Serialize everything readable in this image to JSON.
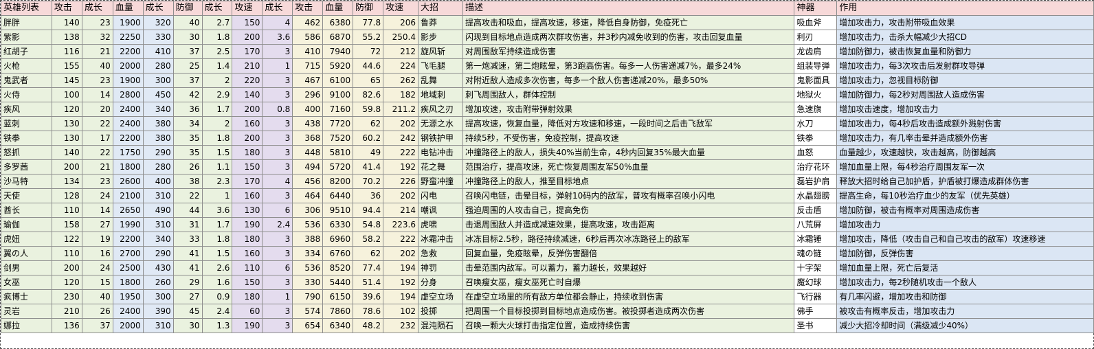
{
  "headers": [
    "英雄列表",
    "攻击",
    "成长",
    "血量",
    "成长",
    "防御",
    "成长",
    "攻速",
    "成长",
    "攻击",
    "血量",
    "防御",
    "攻速",
    "大招",
    "描述",
    "神器",
    "作用"
  ],
  "rows": [
    [
      "胖胖",
      "140",
      "23",
      "1900",
      "320",
      "40",
      "2.7",
      "150",
      "4",
      "462",
      "6380",
      "77.8",
      "206",
      "鲁莽",
      "提高攻击和吸血，提高攻速，移速，降低自身防御，免疫死亡",
      "吸血斧",
      "增加攻击力，攻击附带吸血效果"
    ],
    [
      "紫影",
      "138",
      "32",
      "2250",
      "330",
      "30",
      "1.8",
      "200",
      "3.6",
      "586",
      "6870",
      "55.2",
      "250.4",
      "影步",
      "闪现到目标地点造成两次群攻伤害，并3秒内减免收到的伤害，攻击回复血量",
      "利刃",
      "增加攻击力，击杀大幅减少大招CD"
    ],
    [
      "红胡子",
      "116",
      "21",
      "2200",
      "410",
      "37",
      "2.5",
      "170",
      "3",
      "410",
      "7940",
      "72",
      "212",
      "旋风斩",
      "对周围敌军持续造成伤害",
      "龙齿肩",
      "增加防御力，被击恢复血量和防御力"
    ],
    [
      "火枪",
      "155",
      "40",
      "2000",
      "280",
      "25",
      "1.4",
      "210",
      "1",
      "715",
      "5920",
      "44.6",
      "224",
      "飞毛腿",
      "第一炮减速，第二炮眩晕，第3跑高伤害。每多一人伤害递减7%，最多24%",
      "组装导弹",
      "增加攻击力，每3次攻击后发射群攻导弹"
    ],
    [
      "鬼武者",
      "145",
      "23",
      "1900",
      "300",
      "37",
      "2",
      "220",
      "3",
      "467",
      "6100",
      "65",
      "262",
      "乱舞",
      "对附近敌人造成多次伤害，每多一个敌人伤害递减20%，最多50%",
      "鬼影面具",
      "增加攻击力，忽视目标防御"
    ],
    [
      "火侍",
      "100",
      "14",
      "2800",
      "450",
      "42",
      "2.9",
      "140",
      "3",
      "296",
      "9100",
      "82.6",
      "182",
      "地域刺",
      "刺飞周围敌人，群体控制",
      "地狱火",
      "增加防御力，每2秒对周围敌人造成伤害"
    ],
    [
      "疾风",
      "120",
      "20",
      "2400",
      "340",
      "36",
      "1.7",
      "200",
      "0.8",
      "400",
      "7160",
      "59.8",
      "211.2",
      "疾风之刃",
      "增加攻速，攻击附带弹射效果",
      "急速旗",
      "增加攻击速度，增加攻击力"
    ],
    [
      "蓝刺",
      "130",
      "22",
      "2400",
      "380",
      "34",
      "2",
      "160",
      "3",
      "438",
      "7720",
      "62",
      "202",
      "无源之水",
      "提高攻速，恢复血量，降低对方攻速和移速，一段时间之后击飞敌军",
      "水刀",
      "增加攻击力，每4秒后攻击造成额外溅射伤害"
    ],
    [
      "铁拳",
      "130",
      "17",
      "2200",
      "380",
      "35",
      "1.8",
      "200",
      "3",
      "368",
      "7520",
      "60.2",
      "242",
      "钢铁护甲",
      "持续5秒，不受伤害，免疫控制，提高攻速",
      "铁拳",
      "增加攻击力，有几率击晕并造成额外伤害"
    ],
    [
      "怒抓",
      "140",
      "22",
      "1750",
      "290",
      "35",
      "1.5",
      "180",
      "3",
      "448",
      "5810",
      "49",
      "222",
      "电钻冲击",
      "冲撞路径上的敌人，损失40%当前生命，4秒内回复35%最大血量",
      "血怒",
      "血量越少，攻速越快，攻击越高，防御越高"
    ],
    [
      "多罗茜",
      "200",
      "21",
      "1800",
      "280",
      "26",
      "1.1",
      "150",
      "3",
      "494",
      "5720",
      "41.4",
      "192",
      "花之舞",
      "范围治疗，提高攻速，死亡恢复周围友军50%血量",
      "治疗花环",
      "增加血量上限，每4秒治疗周围友军一次"
    ],
    [
      "沙马特",
      "134",
      "23",
      "2600",
      "400",
      "38",
      "2.3",
      "170",
      "4",
      "456",
      "8200",
      "70.2",
      "226",
      "野蛮冲撞",
      "冲撞路径上的敌人，推至目标地点",
      "磊岩护肩",
      "释放大招时给自己加护盾，护盾被打爆造成群体伤害"
    ],
    [
      "天使",
      "128",
      "24",
      "2100",
      "310",
      "22",
      "1",
      "160",
      "3",
      "464",
      "6440",
      "36",
      "202",
      "闪电",
      "召唤闪电链，击晕目标，弹射10码内的敌军，普攻有概率召唤小闪电",
      "水晶翅膀",
      "提高生命，每10秒治疗血少的友军（优先英雄）"
    ],
    [
      "酋长",
      "110",
      "14",
      "2650",
      "490",
      "44",
      "3.6",
      "130",
      "6",
      "306",
      "9510",
      "94.4",
      "214",
      "嘲讽",
      "强迫周围的人攻击自己，提高免伤",
      "反击盾",
      "增加防御，被击有概率对周围造成伤害"
    ],
    [
      "瑜伽",
      "158",
      "27",
      "1990",
      "310",
      "31",
      "1.7",
      "190",
      "2.4",
      "536",
      "6330",
      "54.8",
      "223.6",
      "虎啸",
      "击退周围敌人并造成减速效果，提高攻速，攻击距离",
      "八荒屏",
      "增加攻击力"
    ],
    [
      "虎妞",
      "122",
      "19",
      "2200",
      "340",
      "33",
      "1.8",
      "180",
      "3",
      "388",
      "6960",
      "58.2",
      "222",
      "冰霜冲击",
      "冰冻目标2.5秒，路径持续减速，6秒后再次冰冻路径上的敌军",
      "冰霜锤",
      "增加攻击，降低（攻击自己和自己攻击的敌军）攻速移速"
    ],
    [
      "翼の人",
      "110",
      "16",
      "2700",
      "290",
      "41",
      "1.5",
      "160",
      "3",
      "334",
      "6760",
      "62",
      "202",
      "急救",
      "回复血量，免疫眩晕，反弹伤害翻倍",
      "魂の链",
      "增加防御，反弹伤害"
    ],
    [
      "剑男",
      "200",
      "24",
      "2500",
      "430",
      "41",
      "2.6",
      "110",
      "6",
      "536",
      "8520",
      "77.4",
      "194",
      "神罚",
      "击晕范围内敌军。可以蓄力，蓄力越长，效果越好",
      "十字架",
      "增加血量上限，死亡后复活"
    ],
    [
      "女巫",
      "120",
      "15",
      "1800",
      "260",
      "29",
      "1.6",
      "150",
      "3",
      "330",
      "5440",
      "51.4",
      "192",
      "分身",
      "召唤瘦女巫，瘦女巫死亡时自爆",
      "魔幻球",
      "增加攻击力，每2秒随机攻击一个敌人"
    ],
    [
      "疯博士",
      "230",
      "40",
      "1950",
      "300",
      "27",
      "0.9",
      "180",
      "1",
      "790",
      "6150",
      "39.6",
      "194",
      "虚空立场",
      "在虚空立场里的所有敌方单位都会静止，持续收到伤害",
      "飞行器",
      "有几率闪避，增加攻击和防御"
    ],
    [
      "灵岩",
      "210",
      "26",
      "2400",
      "390",
      "45",
      "2.4",
      "60",
      "3",
      "574",
      "7860",
      "78.6",
      "102",
      "投掷",
      "把周围一个目标投掷到目标地点造成伤害。被投掷者造成两次伤害",
      "佛手",
      "被攻击有概率反击，增加攻击力"
    ],
    [
      "娜拉",
      "136",
      "37",
      "2000",
      "310",
      "30",
      "1.3",
      "190",
      "3",
      "654",
      "6340",
      "48.2",
      "232",
      "混沌陨石",
      "召唤一颗大火球打击指定位置，造成持续伤害",
      "圣书",
      "减少大招冷却时间（满级减少40%）"
    ]
  ]
}
